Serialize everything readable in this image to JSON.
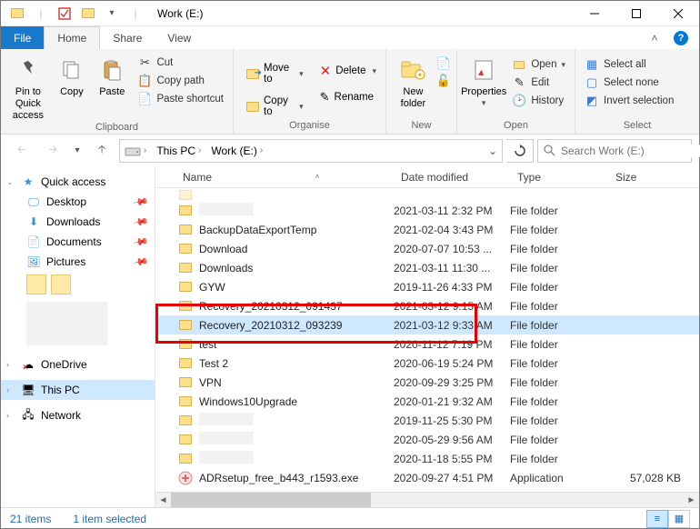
{
  "window": {
    "title": "Work (E:)"
  },
  "tabs": {
    "file": "File",
    "home": "Home",
    "share": "Share",
    "view": "View"
  },
  "ribbon": {
    "pin": "Pin to Quick\naccess",
    "copy": "Copy",
    "paste": "Paste",
    "cut": "Cut",
    "copypath": "Copy path",
    "pasteshortcut": "Paste shortcut",
    "clipboard_label": "Clipboard",
    "moveto": "Move to",
    "copyto": "Copy to",
    "delete": "Delete",
    "rename": "Rename",
    "organise_label": "Organise",
    "newfolder": "New\nfolder",
    "new_label": "New",
    "properties": "Properties",
    "open": "Open",
    "edit": "Edit",
    "history": "History",
    "open_label": "Open",
    "selectall": "Select all",
    "selectnone": "Select none",
    "invertselection": "Invert selection",
    "select_label": "Select"
  },
  "breadcrumb": {
    "seg1": "This PC",
    "seg2": "Work (E:)"
  },
  "search": {
    "placeholder": "Search Work (E:)"
  },
  "nav": {
    "quickaccess": "Quick access",
    "desktop": "Desktop",
    "downloads": "Downloads",
    "documents": "Documents",
    "pictures": "Pictures",
    "onedrive": "OneDrive",
    "thispc": "This PC",
    "network": "Network"
  },
  "columns": {
    "name": "Name",
    "date": "Date modified",
    "type": "Type",
    "size": "Size"
  },
  "files": [
    {
      "name": "",
      "date": "2021-03-11 2:32 PM",
      "type": "File folder",
      "size": "",
      "blurred": true
    },
    {
      "name": "BackupDataExportTemp",
      "date": "2021-02-04 3:43 PM",
      "type": "File folder",
      "size": ""
    },
    {
      "name": "Download",
      "date": "2020-07-07 10:53 ...",
      "type": "File folder",
      "size": ""
    },
    {
      "name": "Downloads",
      "date": "2021-03-11 11:30 ...",
      "type": "File folder",
      "size": ""
    },
    {
      "name": "GYW",
      "date": "2019-11-26 4:33 PM",
      "type": "File folder",
      "size": ""
    },
    {
      "name": "Recovery_20210312_091437",
      "date": "2021-03-12 9:15 AM",
      "type": "File folder",
      "size": ""
    },
    {
      "name": "Recovery_20210312_093239",
      "date": "2021-03-12 9:33 AM",
      "type": "File folder",
      "size": "",
      "selected": true
    },
    {
      "name": "test",
      "date": "2020-11-12 7:19 PM",
      "type": "File folder",
      "size": ""
    },
    {
      "name": "Test 2",
      "date": "2020-06-19 5:24 PM",
      "type": "File folder",
      "size": ""
    },
    {
      "name": "VPN",
      "date": "2020-09-29 3:25 PM",
      "type": "File folder",
      "size": ""
    },
    {
      "name": "Windows10Upgrade",
      "date": "2020-01-21 9:32 AM",
      "type": "File folder",
      "size": ""
    },
    {
      "name": "",
      "date": "2019-11-25 5:30 PM",
      "type": "File folder",
      "size": "",
      "blurred": true
    },
    {
      "name": "",
      "date": "2020-05-29 9:56 AM",
      "type": "File folder",
      "size": "",
      "blurred": true
    },
    {
      "name": "",
      "date": "2020-11-18 5:55 PM",
      "type": "File folder",
      "size": "",
      "blurred": true
    },
    {
      "name": "ADRsetup_free_b443_r1593.exe",
      "date": "2020-09-27 4:51 PM",
      "type": "Application",
      "size": "57,028 KB",
      "exe": true
    }
  ],
  "status": {
    "items": "21 items",
    "selected": "1 item selected"
  },
  "hidden_row": {
    "date_partial": "",
    "type_partial": ""
  }
}
